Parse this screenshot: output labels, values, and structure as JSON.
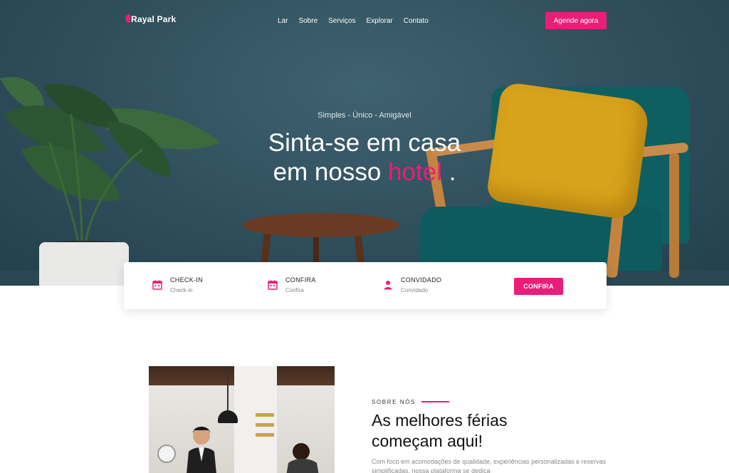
{
  "brand": {
    "name": "Rayal Park",
    "accent": "#e91e78"
  },
  "nav": {
    "items": [
      "Lar",
      "Sobre",
      "Serviços",
      "Explorar",
      "Contato"
    ],
    "cta_label": "Agende agora"
  },
  "hero": {
    "tagline": "Simples - Único - Amigável",
    "headline_line1": "Sinta-se em casa",
    "headline_line2_prefix": "em nosso",
    "headline_highlight": "hotel",
    "headline_suffix": "."
  },
  "booking": {
    "checkin": {
      "label": "CHECK-IN",
      "sub": "Check-in",
      "icon": "calendar-icon"
    },
    "confira": {
      "label": "CONFIRA",
      "sub": "Confira",
      "icon": "calendar-icon"
    },
    "guest": {
      "label": "CONVIDADO",
      "sub": "Convidado",
      "icon": "person-icon"
    },
    "button_label": "CONFIRA"
  },
  "about": {
    "eyebrow": "SOBRE NÓS",
    "title_line1": "As melhores férias",
    "title_line2": "começam aqui!",
    "text": "Com foco em acomodações de qualidade, experiências personalizadas e reservas simplificadas, nossa plataforma se dedica"
  }
}
